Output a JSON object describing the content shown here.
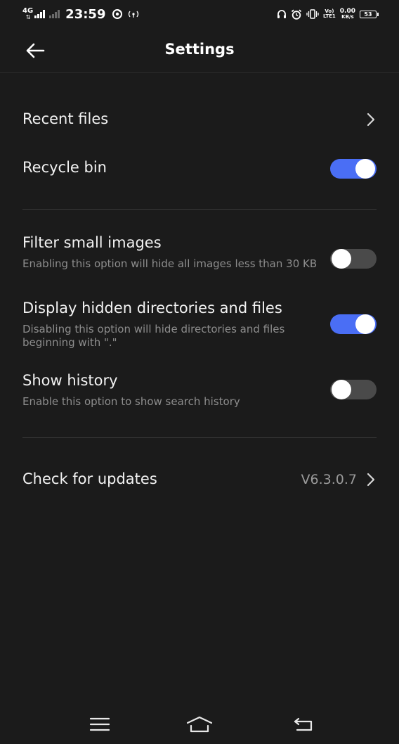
{
  "status_bar": {
    "network": "4G",
    "time": "23:59",
    "lte_top": "Vo)",
    "lte_bottom": "LTE1",
    "speed_top": "0.00",
    "speed_bottom": "KB/s",
    "battery": "53"
  },
  "header": {
    "title": "Settings"
  },
  "settings": {
    "recent_files": {
      "title": "Recent files"
    },
    "recycle_bin": {
      "title": "Recycle bin",
      "enabled": true
    },
    "filter_small_images": {
      "title": "Filter small images",
      "description": "Enabling this option will hide all images less than 30 KB",
      "enabled": false
    },
    "display_hidden": {
      "title": "Display hidden directories and files",
      "description": "Disabling this option will hide directories and files beginning with \".\"",
      "enabled": true
    },
    "show_history": {
      "title": "Show history",
      "description": "Enable this option to show search history",
      "enabled": false
    },
    "check_updates": {
      "title": "Check for updates",
      "version": "V6.3.0.7"
    }
  },
  "colors": {
    "background": "#1b1b1b",
    "accent": "#4a6ef5",
    "toggle_off": "#4a4a4a",
    "secondary_text": "#8d8d8d"
  },
  "icons": {
    "back": "arrow-left-icon",
    "chevron": "chevron-right-icon",
    "menu": "menu-icon",
    "home": "home-icon",
    "return": "back-return-icon"
  }
}
